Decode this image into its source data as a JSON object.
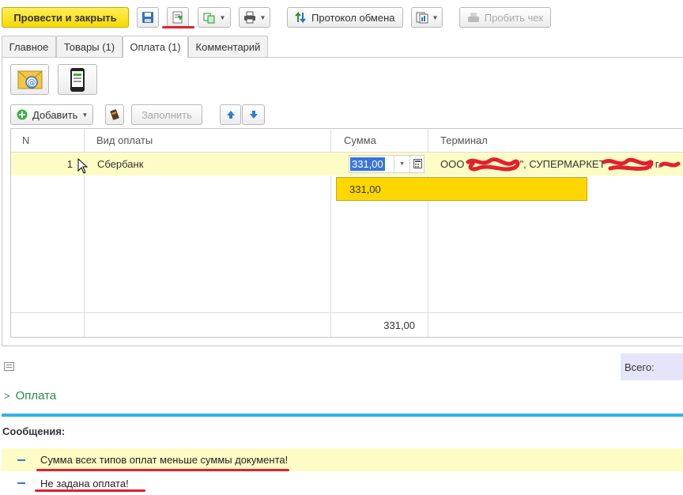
{
  "toolbar": {
    "post_close": "Провести и закрыть",
    "exchange_log": "Протокол обмена",
    "print_check": "Пробить чек"
  },
  "tabs": [
    "Главное",
    "Товары (1)",
    "Оплата (1)",
    "Комментарий"
  ],
  "payment_toolbar": {
    "add": "Добавить",
    "fill": "Заполнить"
  },
  "grid": {
    "columns": [
      "N",
      "Вид оплаты",
      "Сумма",
      "Терминал"
    ],
    "rows": [
      {
        "n": "1",
        "type": "Сбербанк",
        "sum": "331,00",
        "terminal_prefix": "ООО \"",
        "terminal_mid": "\", СУПЕРМАРКЕТ",
        "terminal_tail": ", г."
      }
    ],
    "dropdown_value": "331,00",
    "footer_sum": "331,00"
  },
  "total_label": "Всего:",
  "section_payment": "Оплата",
  "messages": {
    "title": "Сообщения:",
    "items": [
      "Сумма всех типов оплат меньше суммы документа!",
      "Не задана оплата!"
    ]
  },
  "colors": {
    "accent_yellow": "#f5d800",
    "highlight": "#fdfcc4",
    "blue_divider": "#31b3ea",
    "red_mark": "#e2202e"
  }
}
